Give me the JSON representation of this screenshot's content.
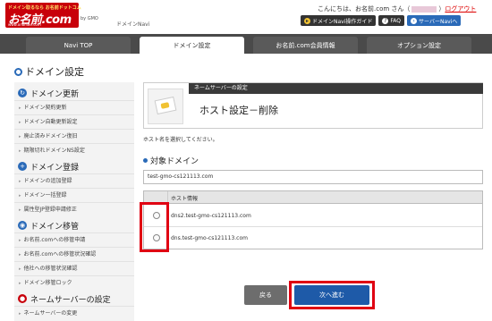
{
  "header": {
    "logo_tag": "ドメイン取るなら お名前ドットコム",
    "logo_main": "お名前.com",
    "logo_url": "www.onamae.com",
    "logo_sub": "by GMO",
    "navi_label": "ドメインNavi",
    "greeting_prefix": "こんにちは、お名前.com さん（",
    "greeting_suffix": "）",
    "logout": "ログアウト",
    "buttons": [
      {
        "label": "ドメインNavi操作ガイド",
        "icon": "guide-icon"
      },
      {
        "label": "FAQ",
        "icon": "question-icon"
      },
      {
        "label": "サーバーNaviへ",
        "icon": "arrow-icon"
      }
    ]
  },
  "tabs": [
    {
      "label": "Navi TOP"
    },
    {
      "label": "ドメイン設定"
    },
    {
      "label": "お名前.com会員情報"
    },
    {
      "label": "オプション設定"
    }
  ],
  "page_title": "ドメイン設定",
  "sidebar": {
    "sections": [
      {
        "title": "ドメイン更新",
        "icon": "refresh-icon",
        "color": "#2a6ab8",
        "items": [
          "ドメイン契約更新",
          "ドメイン自動更新設定",
          "廃止済みドメイン復旧",
          "期限切れドメインNS設定"
        ]
      },
      {
        "title": "ドメイン登録",
        "icon": "plus-icon",
        "color": "#2a6ab8",
        "items": [
          "ドメインの追加登録",
          "ドメイン一括登録",
          "属性型JP登録申請修正"
        ]
      },
      {
        "title": "ドメイン移管",
        "icon": "globe-icon",
        "color": "#2a6ab8",
        "items": [
          "お名前.comへの移管申請",
          "お名前.comへの移管状況確認",
          "他社への移管状況確認",
          "ドメイン移管ロック"
        ]
      },
      {
        "title": "ネームサーバーの設定",
        "icon": "server-icon",
        "color": "#c8000a",
        "items": [
          "ネームサーバーの変更"
        ]
      }
    ]
  },
  "main": {
    "banner_label": "ネームサーバーの設定",
    "banner_title": "ホスト設定－削除",
    "instruction": "ホスト名を選択してください。",
    "target_label": "対象ドメイン",
    "target_domain": "test-gmo-cs121113.com",
    "host_header": "ホスト情報",
    "hosts": [
      "dns2.test-gmo-cs121113.com",
      "dns.test-gmo-cs121113.com"
    ],
    "back_button": "戻る",
    "next_button": "次へ進む"
  },
  "colors": {
    "brand_red": "#c8000a",
    "accent_blue": "#1e5aa8",
    "highlight": "#e00012"
  }
}
